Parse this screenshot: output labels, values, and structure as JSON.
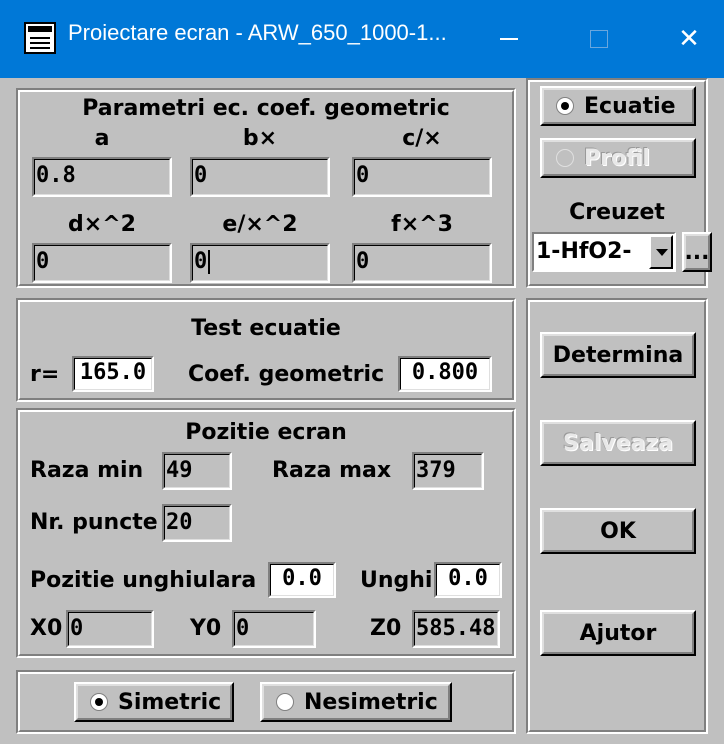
{
  "window": {
    "title": "Proiectare ecran - ARW_650_1000-1...",
    "close_glyph": "✕"
  },
  "parametri": {
    "heading": "Parametri ec. coef. geometric",
    "fields": [
      {
        "label": "a",
        "value": "0.8"
      },
      {
        "label": "b×",
        "value": "0"
      },
      {
        "label": "c/×",
        "value": "0"
      },
      {
        "label": "d×^2",
        "value": "0"
      },
      {
        "label": "e/×^2",
        "value": "0"
      },
      {
        "label": "f×^3",
        "value": "0"
      }
    ]
  },
  "mode": {
    "ecuatie": "Ecuatie",
    "profil": "Profil",
    "selected": "ecuatie",
    "creuzet_label": "Creuzet",
    "creuzet_value": "1-HfO2-",
    "more_label": "..."
  },
  "test": {
    "heading": "Test ecuatie",
    "r_label": "r=",
    "r_value": "165.0",
    "coef_label": "Coef. geometric",
    "coef_value": "0.800"
  },
  "pozitie": {
    "heading": "Pozitie ecran",
    "raza_min_label": "Raza min",
    "raza_min_value": "49",
    "raza_max_label": "Raza max",
    "raza_max_value": "379",
    "nr_puncte_label": "Nr. puncte",
    "nr_puncte_value": "20",
    "unghiulara_label": "Pozitie unghiulara",
    "unghiulara_value": "0.0",
    "unghi_label": "Unghi",
    "unghi_value": "0.0",
    "x0_label": "X0",
    "x0_value": "0",
    "y0_label": "Y0",
    "y0_value": "0",
    "z0_label": "Z0",
    "z0_value": "585.48"
  },
  "simetrie": {
    "simetric": "Simetric",
    "nesimetric": "Nesimetric",
    "selected": "simetric"
  },
  "actions": {
    "determina": "Determina",
    "salveaza": "Salveaza",
    "ok": "OK",
    "ajutor": "Ajutor"
  },
  "colors": {
    "titlebar": "#0078d7",
    "face": "#c0c0c0"
  }
}
